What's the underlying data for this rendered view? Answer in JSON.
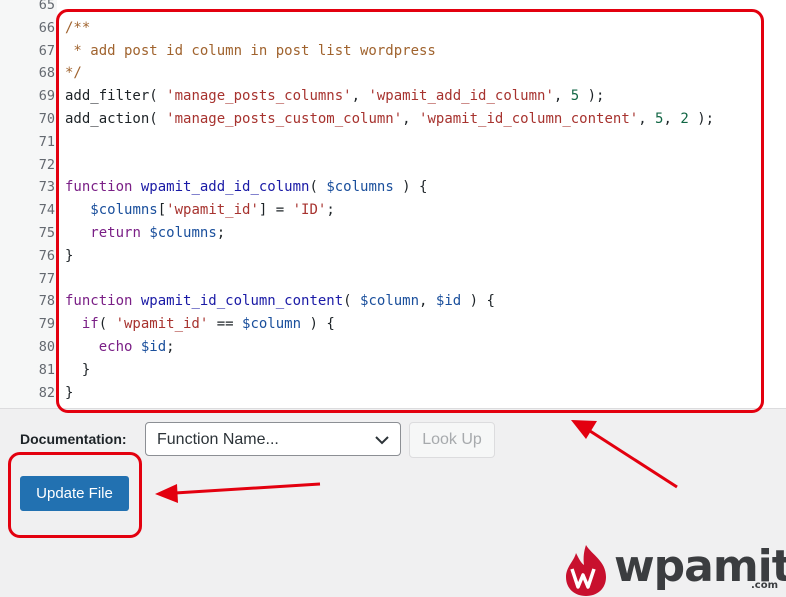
{
  "editor": {
    "lines": [
      {
        "num": "65",
        "segments": []
      },
      {
        "num": "66",
        "segments": [
          {
            "t": "/**",
            "c": "comment"
          }
        ]
      },
      {
        "num": "67",
        "segments": [
          {
            "t": " * add post id column in post list wordpress",
            "c": "comment"
          }
        ]
      },
      {
        "num": "68",
        "segments": [
          {
            "t": "*/",
            "c": "comment"
          }
        ]
      },
      {
        "num": "69",
        "segments": [
          {
            "t": "add_filter( ",
            "c": "plain"
          },
          {
            "t": "'manage_posts_columns'",
            "c": "string"
          },
          {
            "t": ", ",
            "c": "plain"
          },
          {
            "t": "'wpamit_add_id_column'",
            "c": "string"
          },
          {
            "t": ", ",
            "c": "plain"
          },
          {
            "t": "5",
            "c": "number"
          },
          {
            "t": " );",
            "c": "plain"
          }
        ]
      },
      {
        "num": "70",
        "segments": [
          {
            "t": "add_action( ",
            "c": "plain"
          },
          {
            "t": "'manage_posts_custom_column'",
            "c": "string"
          },
          {
            "t": ", ",
            "c": "plain"
          },
          {
            "t": "'wpamit_id_column_content'",
            "c": "string"
          },
          {
            "t": ", ",
            "c": "plain"
          },
          {
            "t": "5",
            "c": "number"
          },
          {
            "t": ", ",
            "c": "plain"
          },
          {
            "t": "2",
            "c": "number"
          },
          {
            "t": " );",
            "c": "plain"
          }
        ]
      },
      {
        "num": "71",
        "segments": []
      },
      {
        "num": "72",
        "segments": []
      },
      {
        "num": "73",
        "segments": [
          {
            "t": "function",
            "c": "kw"
          },
          {
            "t": " ",
            "c": "plain"
          },
          {
            "t": "wpamit_add_id_column",
            "c": "def"
          },
          {
            "t": "( ",
            "c": "plain"
          },
          {
            "t": "$columns",
            "c": "var"
          },
          {
            "t": " ) {",
            "c": "plain"
          }
        ]
      },
      {
        "num": "74",
        "segments": [
          {
            "t": "   ",
            "c": "plain"
          },
          {
            "t": "$columns",
            "c": "var"
          },
          {
            "t": "[",
            "c": "plain"
          },
          {
            "t": "'wpamit_id'",
            "c": "string"
          },
          {
            "t": "] = ",
            "c": "plain"
          },
          {
            "t": "'ID'",
            "c": "string"
          },
          {
            "t": ";",
            "c": "plain"
          }
        ]
      },
      {
        "num": "75",
        "segments": [
          {
            "t": "   ",
            "c": "plain"
          },
          {
            "t": "return",
            "c": "kw"
          },
          {
            "t": " ",
            "c": "plain"
          },
          {
            "t": "$columns",
            "c": "var"
          },
          {
            "t": ";",
            "c": "plain"
          }
        ]
      },
      {
        "num": "76",
        "segments": [
          {
            "t": "}",
            "c": "plain"
          }
        ]
      },
      {
        "num": "77",
        "segments": []
      },
      {
        "num": "78",
        "segments": [
          {
            "t": "function",
            "c": "kw"
          },
          {
            "t": " ",
            "c": "plain"
          },
          {
            "t": "wpamit_id_column_content",
            "c": "def"
          },
          {
            "t": "( ",
            "c": "plain"
          },
          {
            "t": "$column",
            "c": "var"
          },
          {
            "t": ", ",
            "c": "plain"
          },
          {
            "t": "$id",
            "c": "var"
          },
          {
            "t": " ) {",
            "c": "plain"
          }
        ]
      },
      {
        "num": "79",
        "segments": [
          {
            "t": "  ",
            "c": "plain"
          },
          {
            "t": "if",
            "c": "kw"
          },
          {
            "t": "( ",
            "c": "plain"
          },
          {
            "t": "'wpamit_id'",
            "c": "string"
          },
          {
            "t": " == ",
            "c": "plain"
          },
          {
            "t": "$column",
            "c": "var"
          },
          {
            "t": " ) {",
            "c": "plain"
          }
        ]
      },
      {
        "num": "80",
        "segments": [
          {
            "t": "    ",
            "c": "plain"
          },
          {
            "t": "echo",
            "c": "kw"
          },
          {
            "t": " ",
            "c": "plain"
          },
          {
            "t": "$id",
            "c": "var"
          },
          {
            "t": ";",
            "c": "plain"
          }
        ]
      },
      {
        "num": "81",
        "segments": [
          {
            "t": "  }",
            "c": "plain"
          }
        ]
      },
      {
        "num": "82",
        "segments": [
          {
            "t": "}",
            "c": "plain"
          }
        ]
      }
    ]
  },
  "documentation": {
    "label": "Documentation:",
    "select_value": "Function Name...",
    "lookup_label": "Look Up"
  },
  "update_button": {
    "label": "Update File"
  },
  "annotation_color": "#e3000f",
  "logo": {
    "text": "wpamit",
    "sub": ".com",
    "icon": "wpamit-flame-logo-icon"
  }
}
